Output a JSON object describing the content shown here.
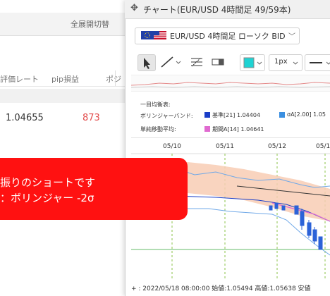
{
  "background_panel": {
    "expand_all_label": "全展開切替",
    "columns": [
      "評価レート",
      "pip損益",
      "ポジ"
    ],
    "row": {
      "rate": "1.04655",
      "pips": "873"
    }
  },
  "chart_window": {
    "title": "チャート(EUR/USD 4時間足 49/59本)",
    "symbol_label": "EUR/USD 4時間足 ローソク BID",
    "toolbar": {
      "width_label": "1px"
    },
    "legend": {
      "title": "一目均衡表:",
      "bollinger_label": "ボリンジャーバンド:",
      "bb_base": "基準[21] 1.04404",
      "bb_sigma": "σA[2.00] 1.05",
      "ma_label": "単純移動平均:",
      "ma_value": "期間A[14] 1.04641"
    },
    "dates": [
      "05/10",
      "05/11",
      "05/12",
      "05/1"
    ],
    "status_bar": "+ : 2022/05/18 08:00:00  始値:1.05494  高値:1.05638  安値",
    "colors": {
      "bb_base": "#1a3ec8",
      "bb_sigma": "#3b8fe0",
      "ma": "#e06ad0",
      "candle": "#2b62d8"
    }
  },
  "annotation": {
    "line1": "振りのショートです",
    "line2": "：ボリンジャー -2σ"
  }
}
